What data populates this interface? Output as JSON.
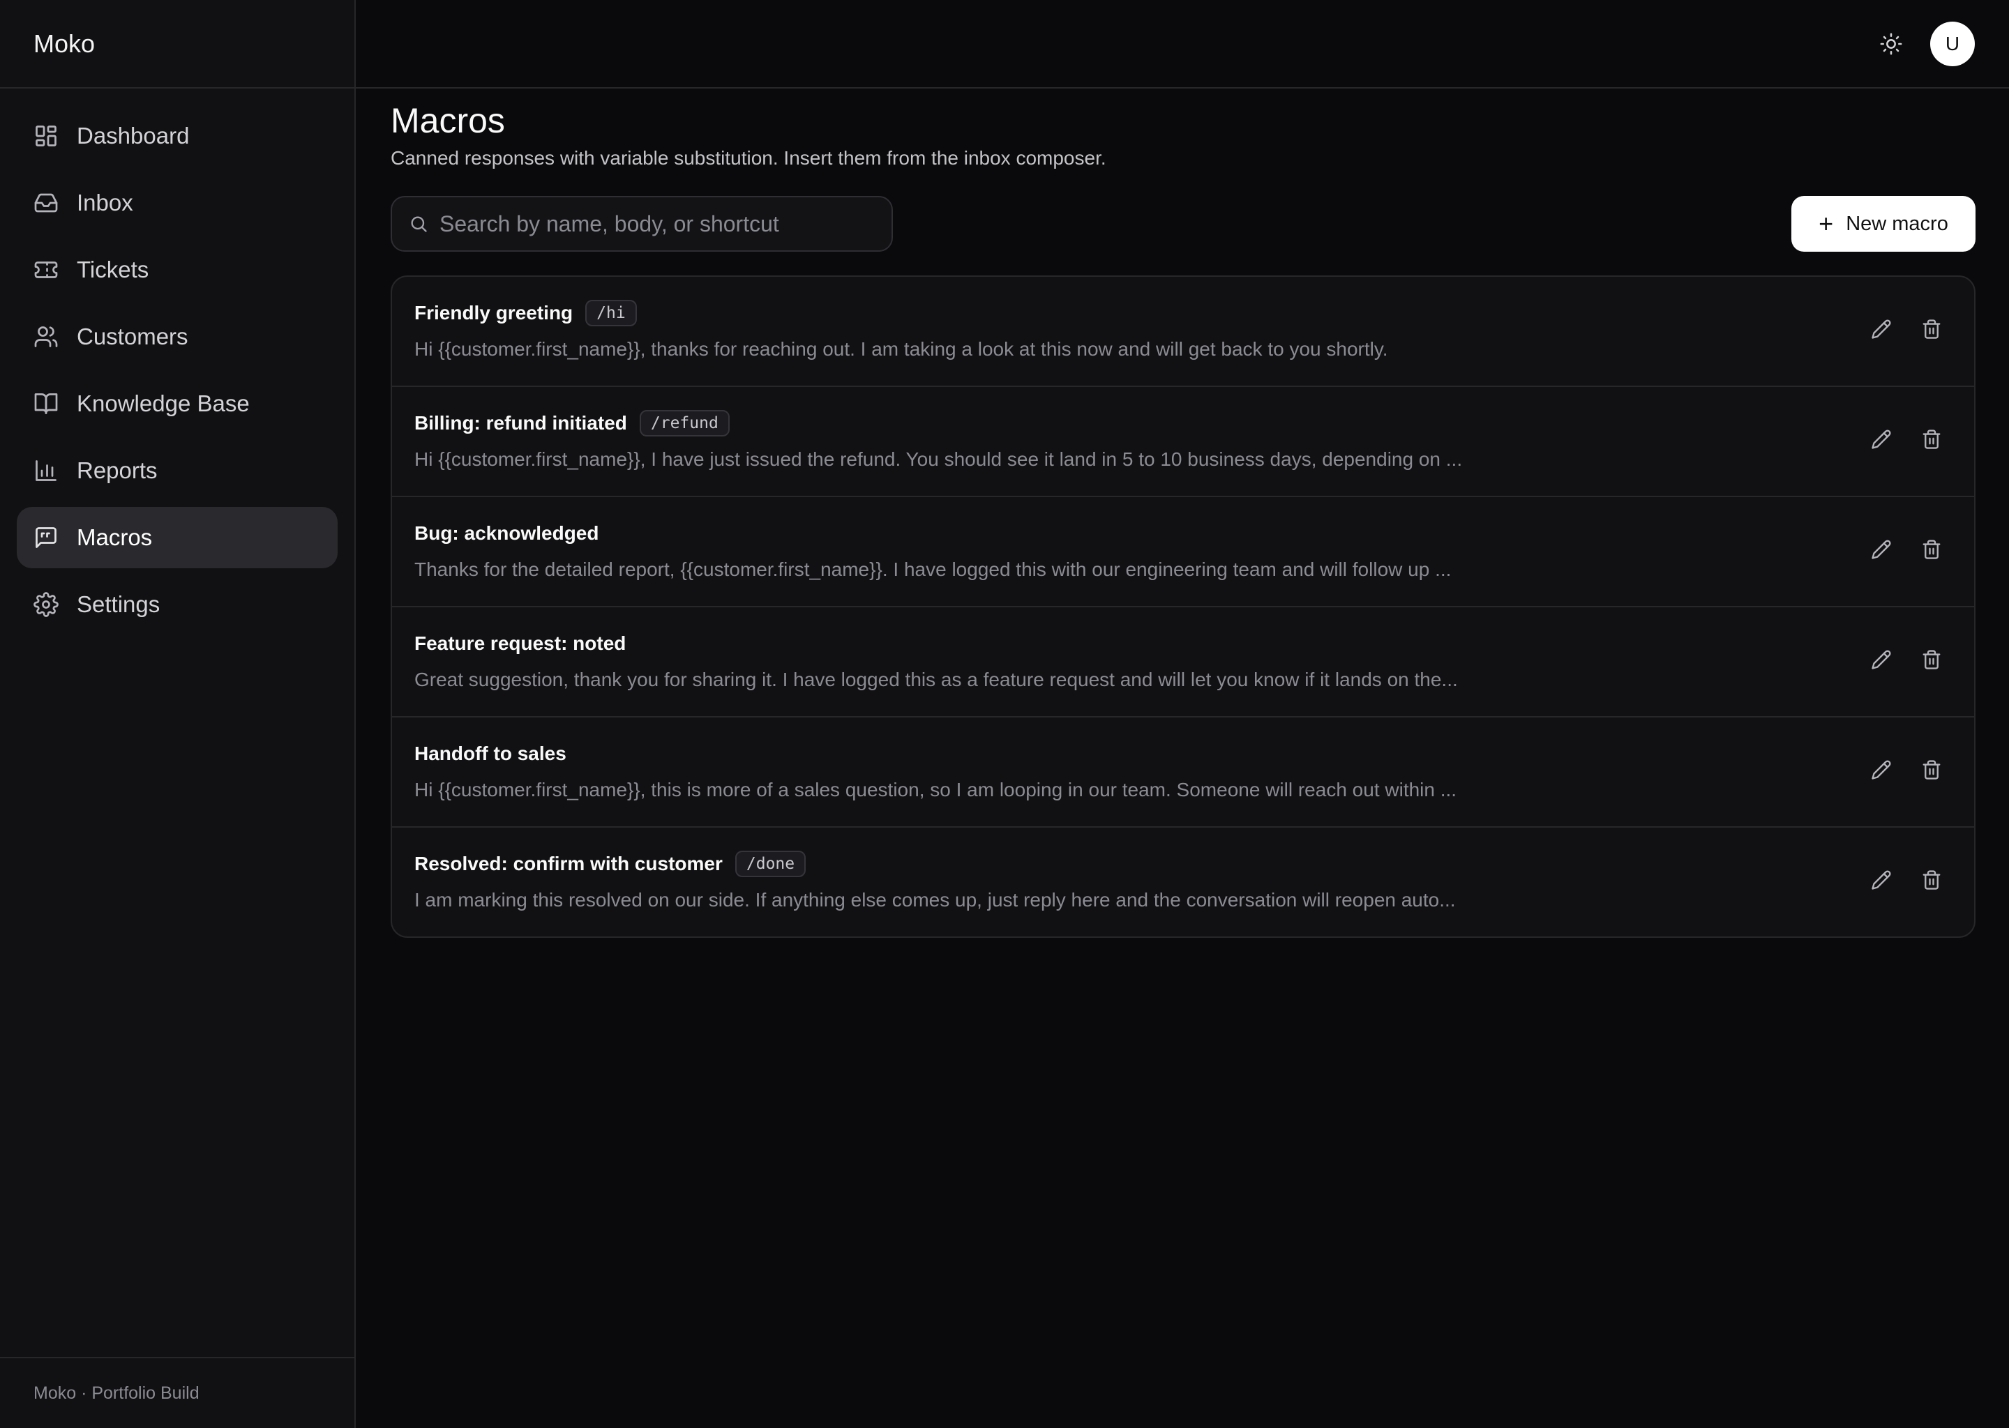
{
  "brand": "Moko",
  "sidebar": {
    "items": [
      {
        "label": "Dashboard",
        "icon": "dashboard-icon"
      },
      {
        "label": "Inbox",
        "icon": "inbox-icon"
      },
      {
        "label": "Tickets",
        "icon": "ticket-icon"
      },
      {
        "label": "Customers",
        "icon": "users-icon"
      },
      {
        "label": "Knowledge Base",
        "icon": "book-icon"
      },
      {
        "label": "Reports",
        "icon": "bar-chart-icon"
      },
      {
        "label": "Macros",
        "icon": "message-quote-icon",
        "active": true
      },
      {
        "label": "Settings",
        "icon": "gear-icon"
      }
    ],
    "footer": "Moko · Portfolio Build"
  },
  "topbar": {
    "theme_icon": "sun-icon",
    "avatar_initial": "U"
  },
  "page": {
    "title": "Macros",
    "subtitle": "Canned responses with variable substitution. Insert them from the inbox composer."
  },
  "search": {
    "placeholder": "Search by name, body, or shortcut",
    "value": ""
  },
  "new_button": {
    "label": "New macro",
    "icon": "plus-icon"
  },
  "macros": [
    {
      "name": "Friendly greeting",
      "shortcut": "/hi",
      "body": "Hi {{customer.first_name}}, thanks for reaching out. I am taking a look at this now and will get back to you shortly."
    },
    {
      "name": "Billing: refund initiated",
      "shortcut": "/refund",
      "body": "Hi {{customer.first_name}}, I have just issued the refund. You should see it land in 5 to 10 business days, depending on ..."
    },
    {
      "name": "Bug: acknowledged",
      "shortcut": "",
      "body": "Thanks for the detailed report, {{customer.first_name}}. I have logged this with our engineering team and will follow up ..."
    },
    {
      "name": "Feature request: noted",
      "shortcut": "",
      "body": "Great suggestion, thank you for sharing it. I have logged this as a feature request and will let you know if it lands on the..."
    },
    {
      "name": "Handoff to sales",
      "shortcut": "",
      "body": "Hi {{customer.first_name}}, this is more of a sales question, so I am looping in our team. Someone will reach out within ..."
    },
    {
      "name": "Resolved: confirm with customer",
      "shortcut": "/done",
      "body": "I am marking this resolved on our side. If anything else comes up, just reply here and the conversation will reopen auto..."
    }
  ],
  "row_actions": {
    "edit_icon": "pencil-icon",
    "delete_icon": "trash-icon"
  }
}
